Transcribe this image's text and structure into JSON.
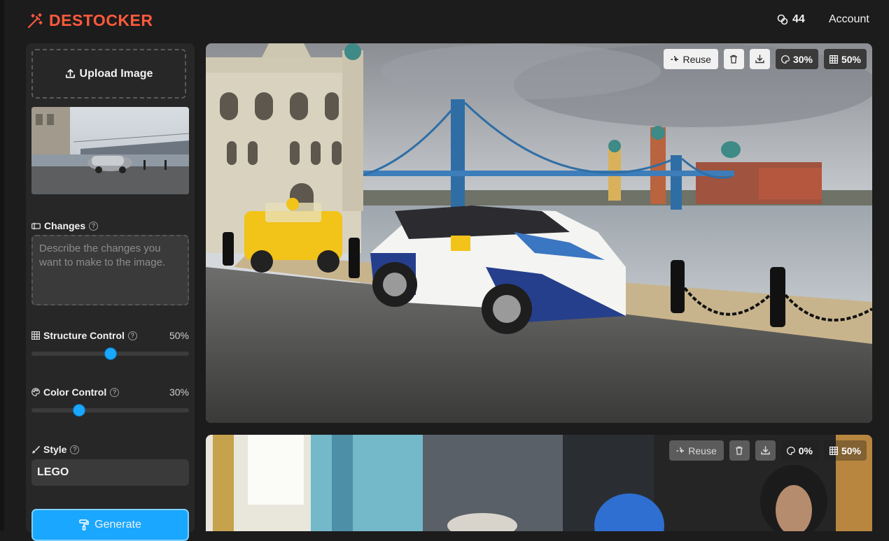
{
  "app": {
    "name": "DESTOCKER",
    "brand_color": "#ff5a3c",
    "accent_color": "#1aa7ff"
  },
  "header": {
    "credits": "44",
    "account_label": "Account"
  },
  "sidebar": {
    "upload_label": "Upload Image",
    "changes_label": "Changes",
    "changes_placeholder": "Describe the changes you want to make to the image.",
    "structure_label": "Structure Control",
    "structure_value": "50%",
    "structure_level": 0.5,
    "color_label": "Color Control",
    "color_value": "30%",
    "color_level": 0.3,
    "style_label": "Style",
    "style_value": "LEGO",
    "generate_label": "Generate"
  },
  "results": [
    {
      "reuse_label": "Reuse",
      "color_pct": "30%",
      "structure_pct": "50%"
    },
    {
      "reuse_label": "Reuse",
      "color_pct": "0%",
      "structure_pct": "50%"
    }
  ]
}
